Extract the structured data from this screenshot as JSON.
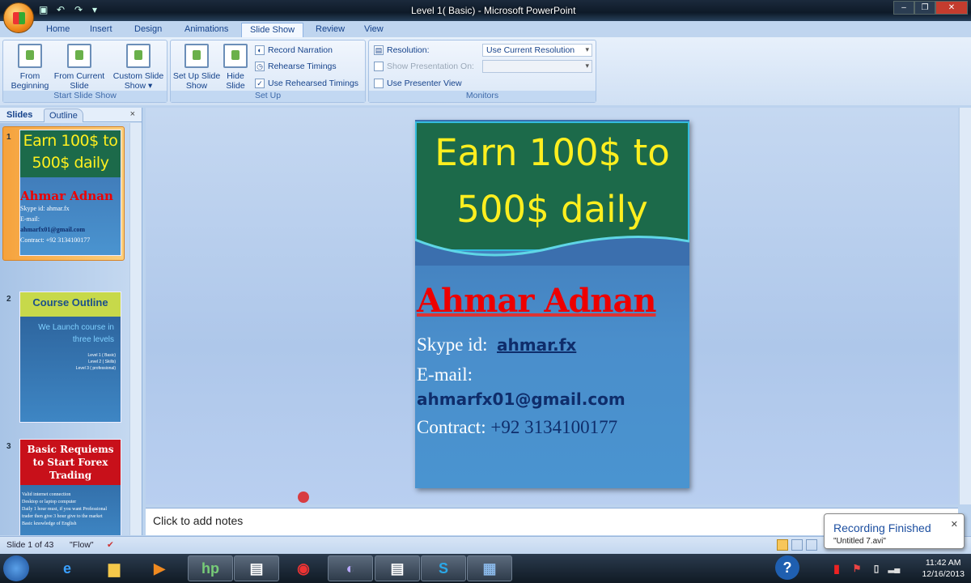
{
  "window": {
    "title": "Level 1( Basic) - Microsoft PowerPoint"
  },
  "tabs": [
    "Home",
    "Insert",
    "Design",
    "Animations",
    "Slide Show",
    "Review",
    "View"
  ],
  "ribbon": {
    "start_group": {
      "label": "Start Slide Show",
      "from_beginning": "From Beginning",
      "from_current": "From Current Slide",
      "custom": "Custom Slide Show ▾"
    },
    "setup_group": {
      "label": "Set Up",
      "setup": "Set Up Slide Show",
      "hide": "Hide Slide",
      "record": "Record Narration",
      "rehearse": "Rehearse Timings",
      "use_rehearsed": "Use Rehearsed Timings",
      "use_rehearsed_checked": true
    },
    "monitors_group": {
      "label": "Monitors",
      "resolution_label": "Resolution:",
      "resolution_value": "Use Current Resolution",
      "show_on_label": "Show Presentation On:",
      "show_on_value": "",
      "presenter_view": "Use Presenter View",
      "presenter_view_checked": false
    }
  },
  "pane": {
    "tab_slides": "Slides",
    "tab_outline": "Outline",
    "close": "×"
  },
  "thumbnails": [
    {
      "num": "1",
      "title": "Earn 100$ to 500$ daily",
      "name": "Ahmar Adnan",
      "skype": "Skype id:  ahmar.fx",
      "email_label": "E-mail:",
      "email": "ahmarfx01@gmail.com",
      "contract": "Contract: +92 3134100177"
    },
    {
      "num": "2",
      "title": "Course Outline",
      "text": "We Launch course in three levels",
      "levels": [
        "Level 1 ( Basic)",
        "Level 2 ( Skills)",
        "Level 3 ( professional)"
      ]
    },
    {
      "num": "3",
      "title": "Basic Requiems to Start  Forex Trading",
      "bullets": [
        "Valid internet connection",
        "Desktop or laptop computer",
        "Daily 1 hour must, if you want Professional trader then give 3 hour give to the market",
        "Basic knowledge of English"
      ]
    }
  ],
  "slide": {
    "title": "Earn 100$ to 500$ daily",
    "name": "Ahmar Adnan",
    "skype_label": "Skype id:",
    "skype_value": "ahmar.fx",
    "email_label": "E-mail:",
    "email_value": "ahmarfx01@gmail.com",
    "contract_label": "Contract:",
    "contract_value": "+92 3134100177"
  },
  "notes": {
    "placeholder": "Click to add notes"
  },
  "status": {
    "slide": "Slide 1 of 43",
    "theme": "\"Flow\""
  },
  "notification": {
    "title": "Recording Finished",
    "file": "\"Untitled 7.avi\""
  },
  "clock": {
    "time": "11:42 AM",
    "date": "12/16/2013"
  }
}
